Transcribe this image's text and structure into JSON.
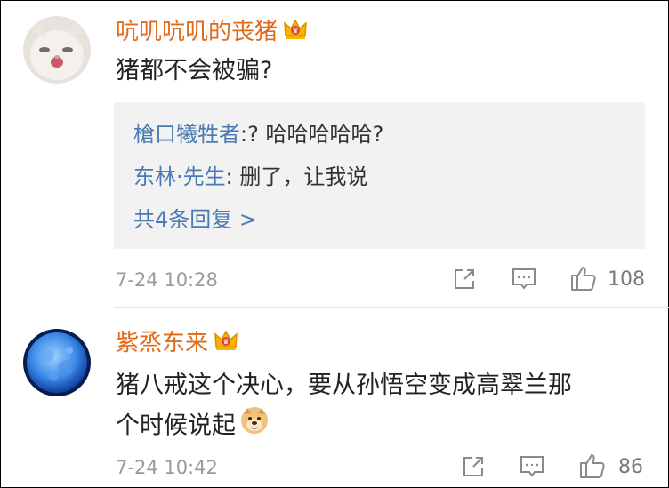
{
  "comments": [
    {
      "username": "吭叽吭叽的丧猪",
      "text": "猪都不会被骗?",
      "replies": [
        {
          "name": "槍口犧牲者",
          "sep": ":",
          "content": "? 哈哈哈哈哈?"
        },
        {
          "name": "东林·先生",
          "sep": ":",
          "content": " 删了，让我说"
        }
      ],
      "more_replies": "共4条回复 >",
      "time": "7-24 10:28",
      "likes": "108"
    },
    {
      "username": "紫烝东来",
      "text_line1": "猪八戒这个决心，要从孙悟空变成高翠兰那",
      "text_line2": "个时候说起",
      "time": "7-24 10:42",
      "likes": "86"
    }
  ],
  "icons": {
    "badge": "crown-badge-icon",
    "share": "share-icon",
    "comment": "comment-icon",
    "like": "thumbs-up-icon",
    "emoji": "doge-emoji"
  },
  "colors": {
    "username": "#e06a1a",
    "link": "#4a7bb3",
    "reply_bg": "#f2f2f2",
    "meta": "#9a9a9a"
  }
}
